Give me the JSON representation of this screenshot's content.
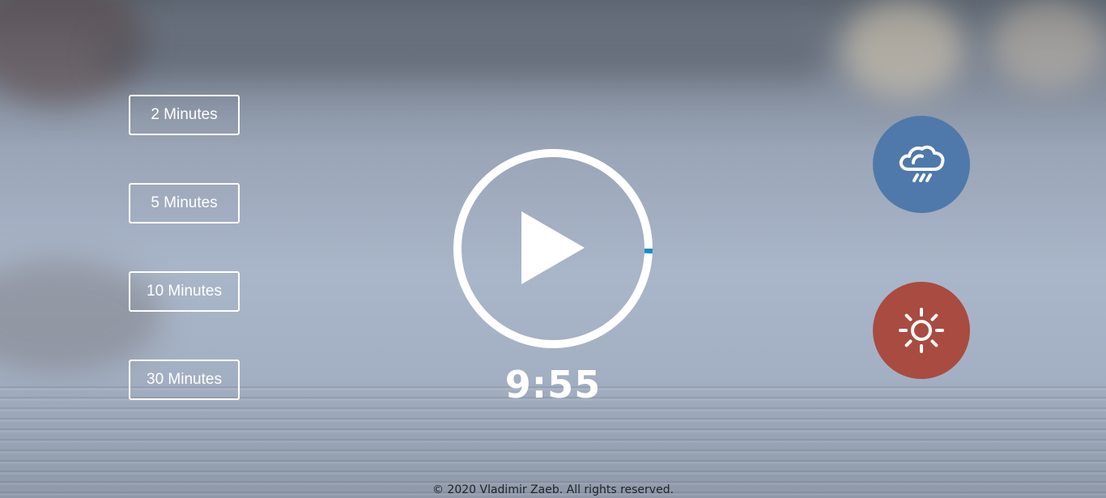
{
  "durations": [
    {
      "label": "2 Minutes"
    },
    {
      "label": "5 Minutes"
    },
    {
      "label": "10 Minutes"
    },
    {
      "label": "30 Minutes"
    }
  ],
  "player": {
    "icon": "play-icon",
    "time_display": "9:55",
    "progress_fraction": 0.008,
    "progress_color": "#1a8fbf",
    "ring_color": "#ffffff"
  },
  "sounds": [
    {
      "name": "rain",
      "icon": "rain-cloud-icon",
      "color": "#4f79aa"
    },
    {
      "name": "summer",
      "icon": "sun-icon",
      "color": "#a94b40"
    }
  ],
  "footer": {
    "copyright": "© 2020 Vladimir Zaeb. All rights reserved."
  }
}
